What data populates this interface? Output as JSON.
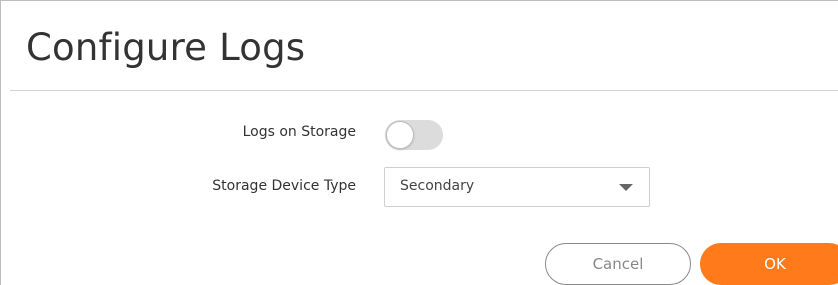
{
  "dialog": {
    "title": "Configure Logs"
  },
  "form": {
    "logs_on_storage": {
      "label": "Logs on Storage",
      "enabled": false
    },
    "storage_device_type": {
      "label": "Storage Device Type",
      "value": "Secondary"
    }
  },
  "buttons": {
    "cancel_label": "Cancel",
    "ok_label": "OK"
  },
  "colors": {
    "accent": "#ff7a1a",
    "toggle_off": "#dcdcdc",
    "text": "#333333"
  },
  "icons": {
    "select_caret": "chevron-down-icon"
  }
}
